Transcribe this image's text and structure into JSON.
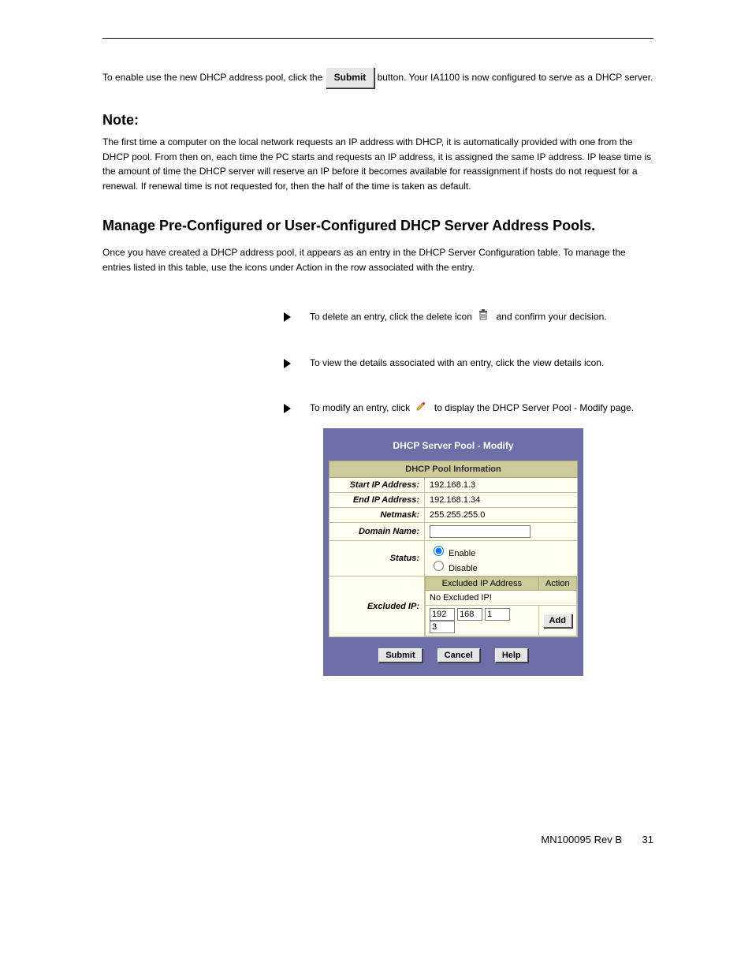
{
  "header": {
    "spacer": "",
    "right": ""
  },
  "intro": {
    "p1_a": "To enable use the new DHCP address pool, click the ",
    "p1_b": "  button. Your IA1100 is now configured to serve as a DHCP server."
  },
  "paragraphs": {
    "p2_heading": "Note:",
    "p2": "The first time a computer on the local network requests an IP address with DHCP, it is automatically provided with one from the DHCP pool. From then on, each time the PC starts and requests an IP address, it is assigned the same IP address. IP lease time is the amount of time the DHCP server will reserve an IP before it becomes available for reassignment if hosts do not request for a renewal. If renewal time is not requested for, then the half of the time is taken as default.",
    "p3": "Manage Pre-Configured or User-Configured DHCP Server Address Pools.",
    "p4": "Once you have created a DHCP address pool, it appears as an entry in the DHCP Server Configuration table. To manage the entries listed in this table, use the icons under Action in the row associated with the entry."
  },
  "bullets": [
    "To delete an entry, click the delete icon           and confirm your decision.",
    "To view the details associated with an entry, click the view details icon.",
    "To modify an entry, click         to display the DHCP Server Pool - Modify page."
  ],
  "submit_button_label": "Submit",
  "panel": {
    "title": "DHCP Server Pool - Modify",
    "section_header": "DHCP Pool Information",
    "rows": {
      "start_ip_label": "Start IP Address:",
      "start_ip_value": "192.168.1.3",
      "end_ip_label": "End IP Address:",
      "end_ip_value": "192.168.1.34",
      "netmask_label": "Netmask:",
      "netmask_value": "255.255.255.0",
      "domain_label": "Domain Name:",
      "domain_value": "",
      "status_label": "Status:",
      "status_enable": "Enable",
      "status_disable": "Disable",
      "excluded_label": "Excluded IP:",
      "excluded_header_addr": "Excluded IP Address",
      "excluded_header_action": "Action",
      "no_excluded": "No Excluded IP!",
      "ip": {
        "o1": "192",
        "o2": "168",
        "o3": "1",
        "o4": "3"
      },
      "add_label": "Add"
    },
    "buttons": {
      "submit": "Submit",
      "cancel": "Cancel",
      "help": "Help"
    }
  },
  "footer": {
    "left": "MN100095 Rev B",
    "right": "31"
  }
}
